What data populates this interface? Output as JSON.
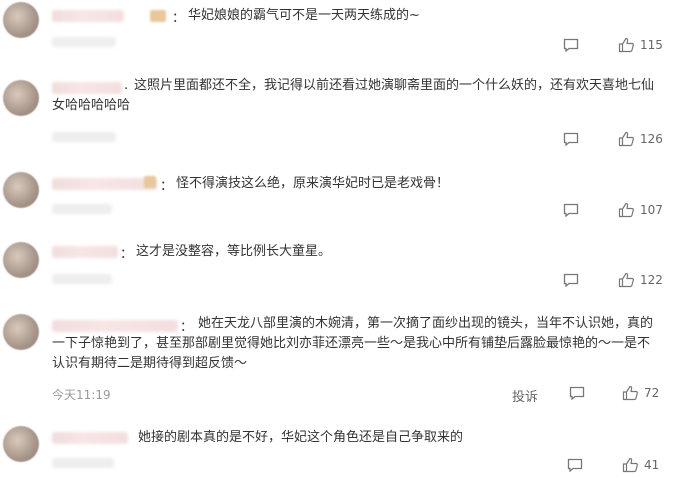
{
  "ui": {
    "colon": "：",
    "reply_icon": "comment-icon",
    "like_icon": "thumbs-up-icon"
  },
  "comments": [
    {
      "text": "华妃娘娘的霸气可不是一天两天练成的~",
      "likes": "115"
    },
    {
      "text": "这照片里面都还不全，我记得以前还看过她演聊斋里面的一个什么妖的，还有欢天喜地七仙\n女哈哈哈哈哈",
      "likes": "126"
    },
    {
      "text": "怪不得演技这么绝，原来演华妃时已是老戏骨！",
      "likes": "107"
    },
    {
      "text": "这才是没整容，等比例长大童星。",
      "likes": "122"
    },
    {
      "text": "她在天龙八部里演的木婉清，第一次摘了面纱出现的镜头，当年不认识她，真的\n一下子惊艳到了，甚至那部剧里觉得她比刘亦菲还漂亮一些～是我心中所有铺垫后露脸最惊艳的～一是不\n认识有期待二是期待得到超反馈～",
      "time": "今天11:19",
      "report": "投诉",
      "likes": "72"
    },
    {
      "text": "她接的剧本真的是不好，华妃这个角色还是自己争取来的",
      "likes": "41"
    }
  ]
}
